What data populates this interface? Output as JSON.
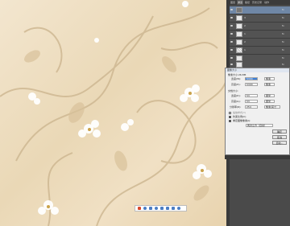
{
  "panel_tabs": [
    "图层",
    "通道",
    "路径",
    "历史记录",
    "动作"
  ],
  "layers": [
    {
      "name": "",
      "thumb": "dark",
      "selected": true,
      "fx": "fx"
    },
    {
      "name": "3",
      "thumb": "plain",
      "selected": false,
      "fx": "fx"
    },
    {
      "name": "2",
      "thumb": "plain",
      "selected": false,
      "fx": "fx"
    },
    {
      "name": "1",
      "thumb": "plain",
      "selected": false,
      "fx": "fx"
    },
    {
      "name": "2",
      "thumb": "plain",
      "selected": false,
      "fx": "fx"
    },
    {
      "name": "1",
      "thumb": "check",
      "selected": false,
      "fx": "fx"
    },
    {
      "name": "",
      "thumb": "plain",
      "selected": false,
      "fx": "fx"
    },
    {
      "name": "",
      "thumb": "plain",
      "selected": false,
      "fx": "fx"
    }
  ],
  "dialog": {
    "title": "图像大小",
    "pixel_dimensions": "像素大小:26.8M",
    "width_label": "宽度(W):",
    "width_value": "5300",
    "height_label": "高度(H):",
    "height_value": "5300",
    "unit_pixels": "像素",
    "document_size": "文档大小:",
    "doc_width_label": "宽度(D):",
    "doc_width_value": "53",
    "doc_height_label": "高度(G):",
    "doc_height_value": "53",
    "unit_cm": "厘米",
    "resolution_label": "分辨率(R):",
    "resolution_value": "254",
    "resolution_unit": "像素/英寸",
    "scale_styles": "缩放样式(Y)",
    "constrain": "约束比例(C)",
    "resample": "重定图像像素(I):",
    "interp": "两次立方（自动）",
    "ok_button": "确定",
    "cancel_button": "取消",
    "auto_button": "自动..."
  },
  "colors": {
    "selected_layer": "#6f87a6",
    "panel_bg": "#4a4a4a"
  }
}
